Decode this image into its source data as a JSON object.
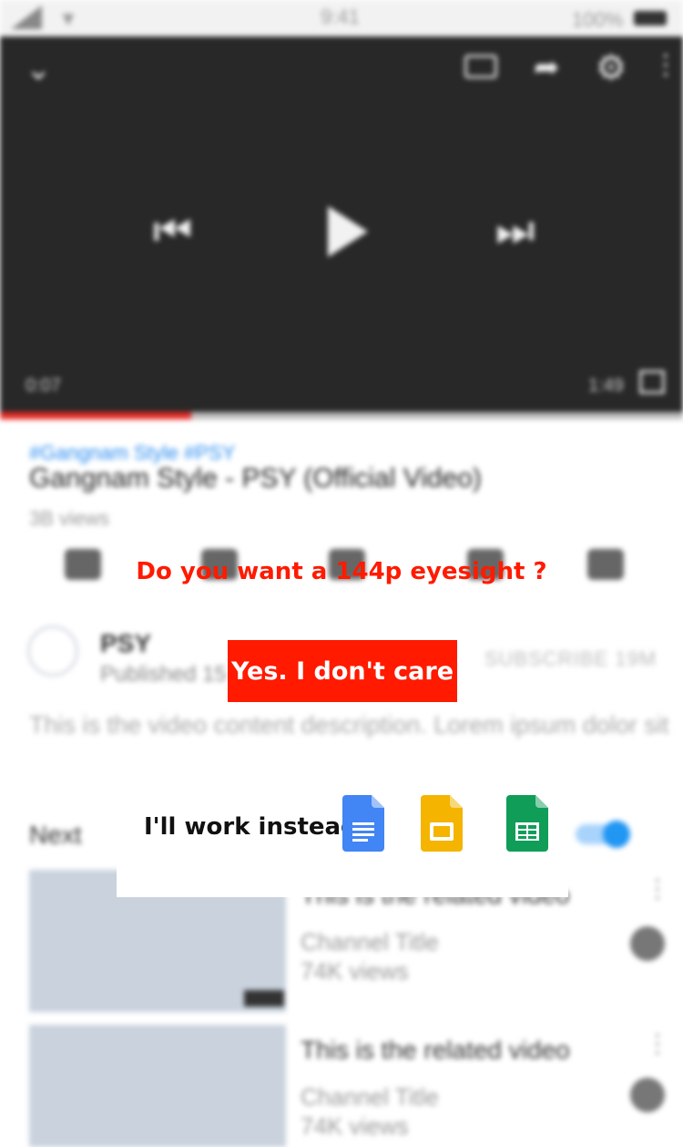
{
  "status_bar": {
    "time": "9:41",
    "battery_pct": "100%"
  },
  "player": {
    "current_time": "0:07",
    "duration": "1:49",
    "progress": 0.28
  },
  "video": {
    "hashtags": "#Gangnam Style #PSY",
    "title": "Gangnam Style - PSY (Official Video)",
    "views": "3B views"
  },
  "channel": {
    "name": "PSY",
    "published": "Published 15 Jul 2012",
    "subscribers": "SUBSCRIBE 19M"
  },
  "description": "This is the video content description. Lorem ipsum dolor sit",
  "up_next": {
    "label": "Next"
  },
  "related": [
    {
      "title": "This is the related video",
      "channel": "Channel Title",
      "views": "74K views"
    },
    {
      "title": "This is the related video",
      "channel": "Channel Title",
      "views": "74K views"
    }
  ],
  "overlay": {
    "question": "Do you want a 144p eyesight ?",
    "yes_button": "Yes. I don't care",
    "work_text": "I'll work instead!",
    "apps": [
      {
        "icon": "google-docs-icon",
        "color": "#4285f4"
      },
      {
        "icon": "google-slides-icon",
        "color": "#f4b400"
      },
      {
        "icon": "google-sheets-icon",
        "color": "#0f9d58"
      }
    ]
  }
}
